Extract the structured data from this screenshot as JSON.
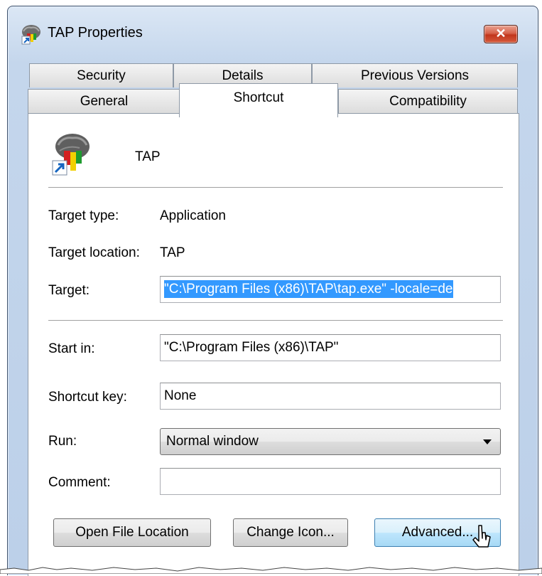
{
  "window": {
    "title": "TAP Properties",
    "close_label": "✕"
  },
  "tabs": {
    "row_back": [
      "Security",
      "Details",
      "Previous Versions"
    ],
    "row_front": [
      "General",
      "Shortcut",
      "Compatibility"
    ],
    "active": "Shortcut"
  },
  "shortcut": {
    "name": "TAP",
    "target_type_label": "Target type:",
    "target_type_value": "Application",
    "target_location_label": "Target location:",
    "target_location_value": "TAP",
    "target_label": "Target:",
    "target_value": "\"C:\\Program Files (x86)\\TAP\\tap.exe\" -locale=de",
    "start_in_label": "Start in:",
    "start_in_value": "\"C:\\Program Files (x86)\\TAP\"",
    "shortcut_key_label": "Shortcut key:",
    "shortcut_key_value": "None",
    "run_label": "Run:",
    "run_value": "Normal window",
    "comment_label": "Comment:",
    "comment_value": ""
  },
  "buttons": {
    "open_file_location": "Open File Location",
    "change_icon": "Change Icon...",
    "advanced": "Advanced..."
  },
  "colors": {
    "selection": "#3399ff",
    "close_button": "#c1361c",
    "hover_button": "#bee6fd"
  }
}
